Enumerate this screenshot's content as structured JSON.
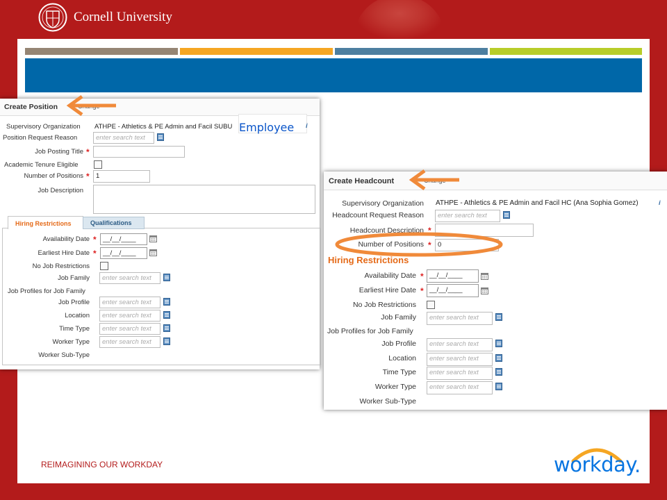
{
  "header": {
    "logo_text": "Cornell University"
  },
  "stripes": [
    {
      "color": "#958574"
    },
    {
      "color": "#f5a623"
    },
    {
      "color": "#4d7fa0"
    },
    {
      "color": "#b8cd29"
    }
  ],
  "create_position": {
    "title": "Create Position",
    "change_label": "Change",
    "info_icon": "i",
    "employee_overlay": "Employee",
    "fields": {
      "sup_org_label": "Supervisory Organization",
      "sup_org_value": "ATHPE - Athletics & PE Admin and Facil SUBU",
      "reason_label": "Position Request Reason",
      "reason_placeholder": "enter search text",
      "posting_title_label": "Job Posting Title",
      "tenure_label": "Academic Tenure Eligible",
      "num_positions_label": "Number of Positions",
      "num_positions_value": "1",
      "job_desc_label": "Job Description"
    },
    "tabs": [
      "Hiring Restrictions",
      "Qualifications"
    ],
    "restrictions": {
      "availability_label": "Availability Date",
      "availability_value": "__/__/____",
      "earliest_label": "Earliest Hire Date",
      "earliest_value": "__/__/____",
      "no_restrictions_label": "No Job Restrictions",
      "job_family_label": "Job Family",
      "job_profiles_for_family_label": "Job Profiles for Job Family",
      "job_profile_label": "Job Profile",
      "location_label": "Location",
      "time_type_label": "Time Type",
      "worker_type_label": "Worker Type",
      "worker_subtype_label": "Worker Sub-Type",
      "placeholder": "enter search text"
    }
  },
  "create_headcount": {
    "title": "Create Headcount",
    "change_label": "Change",
    "info_icon": "i",
    "fields": {
      "sup_org_label": "Supervisory Organization",
      "sup_org_value": "ATHPE - Athletics & PE Admin and Facil HC (Ana Sophia Gomez)",
      "reason_label": "Headcount Request Reason",
      "reason_placeholder": "enter search text",
      "desc_label": "Headcount Description",
      "num_positions_label": "Number of Positions",
      "num_positions_value": "0"
    },
    "section_title": "Hiring Restrictions",
    "restrictions": {
      "availability_label": "Availability Date",
      "availability_value": "__/__/____",
      "earliest_label": "Earliest Hire Date",
      "earliest_value": "__/__/____",
      "no_restrictions_label": "No Job Restrictions",
      "job_family_label": "Job Family",
      "job_profiles_for_family_label": "Job Profiles for Job Family",
      "job_profile_label": "Job Profile",
      "location_label": "Location",
      "time_type_label": "Time Type",
      "worker_type_label": "Worker Type",
      "worker_subtype_label": "Worker Sub-Type",
      "placeholder": "enter search text"
    }
  },
  "footer": {
    "tagline": "REIMAGINING  OUR WORKDAY",
    "brand": "workday",
    "brand_mark": "."
  },
  "colors": {
    "cornell_red": "#b31b1b",
    "banner_blue": "#0067a8",
    "annotation_orange": "#f08a3a",
    "workday_blue": "#0875e1",
    "workday_orange": "#f5a623",
    "overlay_text_blue": "#0a55c9"
  }
}
